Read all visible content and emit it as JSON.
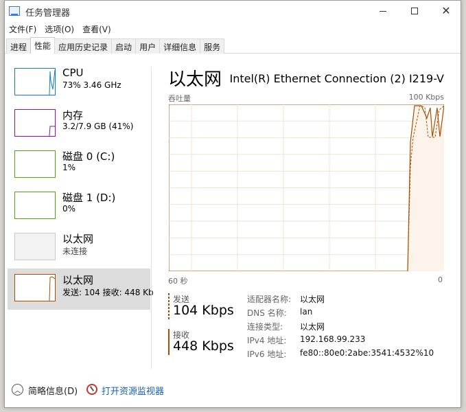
{
  "window": {
    "title": "任务管理器",
    "controls": {
      "minimize": "",
      "maximize": "",
      "close": "✕"
    }
  },
  "menu": [
    "文件(F)",
    "选项(O)",
    "查看(V)"
  ],
  "tabs": [
    "进程",
    "性能",
    "应用历史记录",
    "启动",
    "用户",
    "详细信息",
    "服务"
  ],
  "active_tab": "性能",
  "sidebar": {
    "items": [
      {
        "name": "CPU",
        "sub": "73%  3.46 GHz",
        "color": "#117dbb",
        "selected": false
      },
      {
        "name": "内存",
        "sub": "3.2/7.9 GB (41%)",
        "color": "#8b12ae",
        "selected": false
      },
      {
        "name": "磁盘 0 (C:)",
        "sub": "1%",
        "color": "#4da60c",
        "selected": false
      },
      {
        "name": "磁盘 1 (D:)",
        "sub": "0%",
        "color": "#4da60c",
        "selected": false
      },
      {
        "name": "以太网",
        "sub": "未连接",
        "color": "#c8c8c8",
        "selected": false
      },
      {
        "name": "以太网",
        "sub": "发送: 104  接收: 448 Kb",
        "color": "#a74f01",
        "selected": true
      }
    ]
  },
  "main": {
    "title": "以太网",
    "adapter": "Intel(R) Ethernet Connection (2) I219-V",
    "graph_label": "吞吐量",
    "graph_max": "100 Kbps",
    "time_left": "60 秒",
    "time_right": "0",
    "send_label": "发送",
    "send_value": "104 Kbps",
    "recv_label": "接收",
    "recv_value": "448 Kbps",
    "properties": [
      {
        "key": "适配器名称:",
        "value": "以太网"
      },
      {
        "key": "DNS 名称:",
        "value": "lan"
      },
      {
        "key": "连接类型:",
        "value": "以太网"
      },
      {
        "key": "IPv4 地址:",
        "value": "192.168.99.233"
      },
      {
        "key": "IPv6 地址:",
        "value": "fe80::80e0:2abe:3541:4532%10"
      }
    ]
  },
  "footer": {
    "fewer_details": "简略信息(D)",
    "resource_monitor": "打开资源监视器"
  },
  "colors": {
    "ethernet": "#a74f01",
    "graph_fill": "#fcf3eb",
    "grid": "#f0e2d3"
  }
}
